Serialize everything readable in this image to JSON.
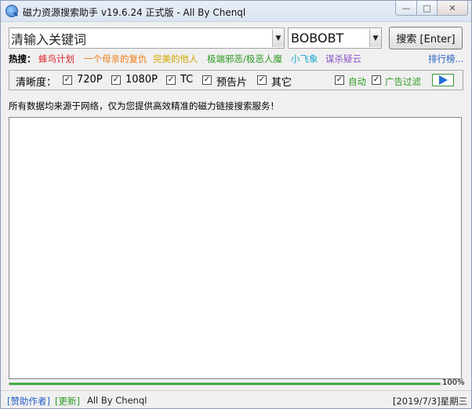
{
  "window": {
    "title": "磁力资源搜索助手 v19.6.24 正式版 - All By Chenql"
  },
  "search": {
    "keyword_value": "清输入关键词",
    "site_value": "BOBOBT",
    "search_button": "搜索 [Enter]"
  },
  "hot": {
    "label": "热搜：",
    "items": [
      {
        "label": "蜂鸟计划",
        "color": "#e0202a"
      },
      {
        "label": "一个母亲的复仇",
        "color": "#f07d16"
      },
      {
        "label": "完美的他人",
        "color": "#d2a600"
      },
      {
        "label": "极端邪恶/极恶人魔",
        "color": "#2e9a24"
      },
      {
        "label": "小飞象",
        "color": "#17a9c9"
      },
      {
        "label": "谋杀疑云",
        "color": "#8a56c8"
      }
    ],
    "rank_link": "排行榜..."
  },
  "options": {
    "clarity_label": "清晰度：",
    "checks": [
      {
        "label": "720P",
        "checked": true
      },
      {
        "label": "1080P",
        "checked": true
      },
      {
        "label": "TC",
        "checked": true
      },
      {
        "label": "预告片",
        "checked": true
      },
      {
        "label": "其它",
        "checked": true
      }
    ],
    "auto": {
      "label": "自动",
      "checked": true
    },
    "ad_filter": {
      "label": "广告过滤",
      "checked": true
    },
    "check_mark": "✓"
  },
  "notice": "所有数据均来源于网络，仅为您提供高效精准的磁力链接搜索服务！",
  "progress": {
    "value": 1.0,
    "label": "100%"
  },
  "status": {
    "donate": "[赞助作者]",
    "update": "[更新]",
    "author": "All By Chenql",
    "date": "[2019/7/3]星期三"
  }
}
